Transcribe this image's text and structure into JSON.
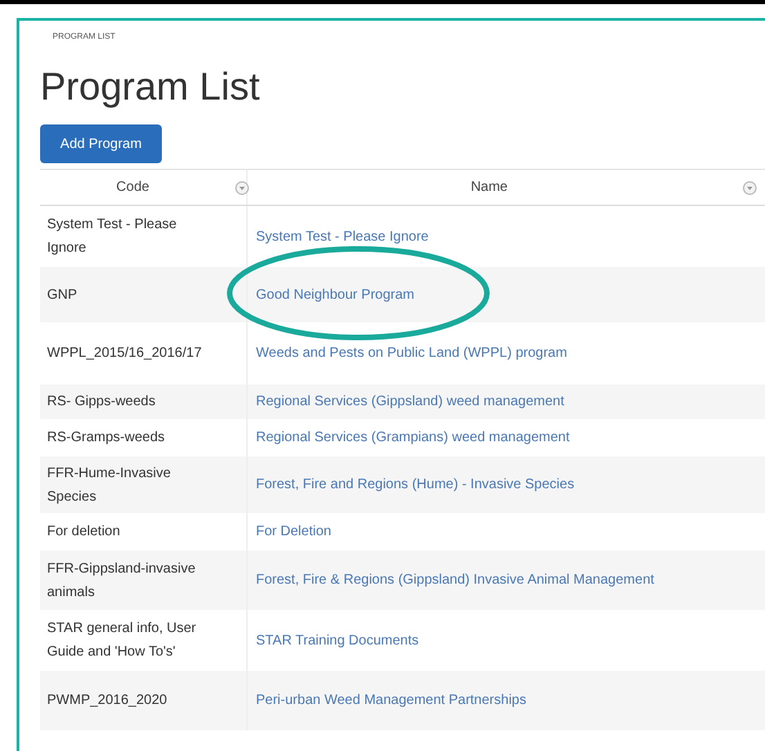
{
  "breadcrumb": "PROGRAM LIST",
  "title": "Program List",
  "add_button": "Add Program",
  "table": {
    "columns": [
      {
        "label": "Code"
      },
      {
        "label": "Name"
      }
    ],
    "rows": [
      {
        "code": "System Test - Please Ignore",
        "name": "System Test - Please Ignore",
        "circled": false
      },
      {
        "code": "GNP",
        "name": "Good Neighbour Program",
        "circled": true
      },
      {
        "code": "WPPL_2015/16_2016/17",
        "name": "Weeds and Pests on Public Land (WPPL) program",
        "circled": false
      },
      {
        "code": "RS- Gipps-weeds",
        "name": "Regional Services (Gippsland) weed management",
        "circled": false
      },
      {
        "code": "RS-Gramps-weeds",
        "name": "Regional Services (Grampians) weed management",
        "circled": false
      },
      {
        "code": "FFR-Hume-Invasive Species",
        "name": "Forest, Fire and Regions (Hume) - Invasive Species",
        "circled": false
      },
      {
        "code": "For deletion",
        "name": "For Deletion",
        "circled": false
      },
      {
        "code": "FFR-Gippsland-invasive animals",
        "name": "Forest, Fire & Regions (Gippsland) Invasive Animal Management",
        "circled": false
      },
      {
        "code": "STAR general info, User Guide and 'How To's'",
        "name": "STAR Training Documents",
        "circled": false
      },
      {
        "code": "PWMP_2016_2020",
        "name": "Peri-urban Weed Management Partnerships",
        "circled": false
      }
    ]
  }
}
